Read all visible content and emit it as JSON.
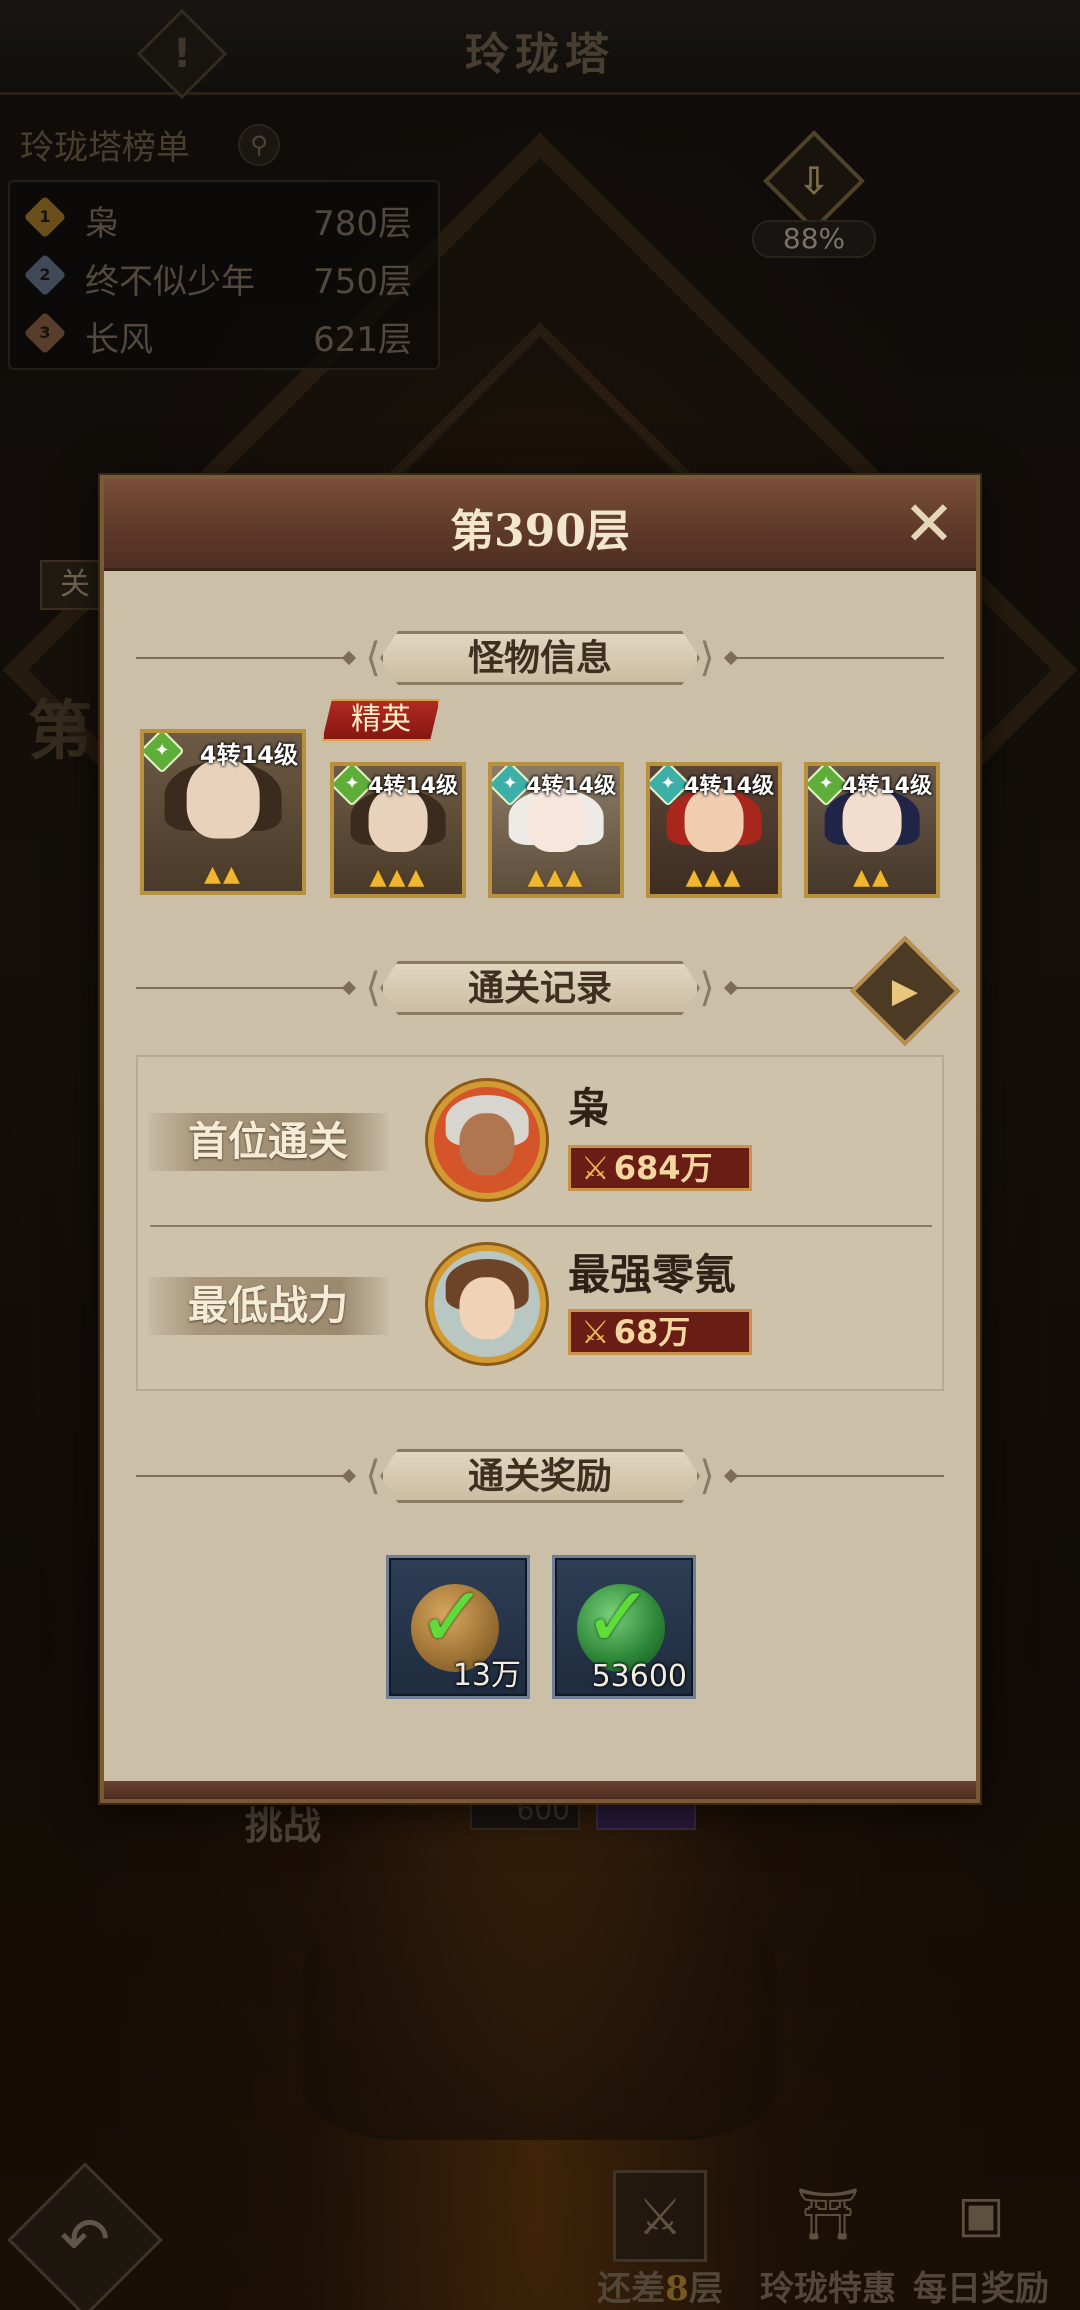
{
  "screen": {
    "title": "玲珑塔"
  },
  "ranking": {
    "title": "玲珑塔榜单",
    "entries": [
      {
        "rank": "1",
        "name": "枭",
        "floor": "780层",
        "color": "#b8892e"
      },
      {
        "rank": "2",
        "name": "终不似少年",
        "floor": "750层",
        "color": "#6e7f94"
      },
      {
        "rank": "3",
        "name": "长风",
        "floor": "621层",
        "color": "#9a6a4a"
      }
    ]
  },
  "progress": {
    "percent": "88%"
  },
  "background": {
    "side_tag": "关",
    "side_big": "第",
    "challenge_label": "挑战",
    "challenge_cost": "600"
  },
  "bottom_nav": {
    "remaining_prefix": "还差",
    "remaining_count": "8",
    "remaining_suffix": "层",
    "special_label": "玲珑特惠",
    "daily_label": "每日奖励"
  },
  "modal": {
    "title": "第390层",
    "monster_section": "怪物信息",
    "elite_label": "精英",
    "monsters": [
      {
        "level": "4转14级",
        "elite": true,
        "hair": "#3b2a1e",
        "face": "#e9d2bb",
        "type_color": "#5fae3a"
      },
      {
        "level": "4转14级",
        "elite": false,
        "hair": "#3b2a1e",
        "face": "#e9d2bb",
        "type_color": "#5fae3a"
      },
      {
        "level": "4转14级",
        "elite": false,
        "hair": "#eeeae6",
        "face": "#f6e6dc",
        "type_color": "#3cb0a8"
      },
      {
        "level": "4转14级",
        "elite": false,
        "hair": "#a8261c",
        "face": "#f0cdb0",
        "type_color": "#3cb0a8"
      },
      {
        "level": "4转14级",
        "elite": false,
        "hair": "#202446",
        "face": "#f3ddcc",
        "type_color": "#5fae3a"
      }
    ],
    "record_section": "通关记录",
    "records": [
      {
        "label": "首位通关",
        "name": "枭",
        "power": "684万",
        "hair": "#d8d4ce",
        "face": "#b07650",
        "bg": "#d5552a"
      },
      {
        "label": "最低战力",
        "name": "最强零氪",
        "power": "68万",
        "hair": "#6e4428",
        "face": "#f0d2b6",
        "bg": "#b8c7c2"
      }
    ],
    "reward_section": "通关奖励",
    "rewards": [
      {
        "qty": "13万",
        "orb": "#a07436",
        "name": "coin"
      },
      {
        "qty": "53600",
        "orb": "#2f8a3a",
        "name": "jade"
      }
    ]
  }
}
